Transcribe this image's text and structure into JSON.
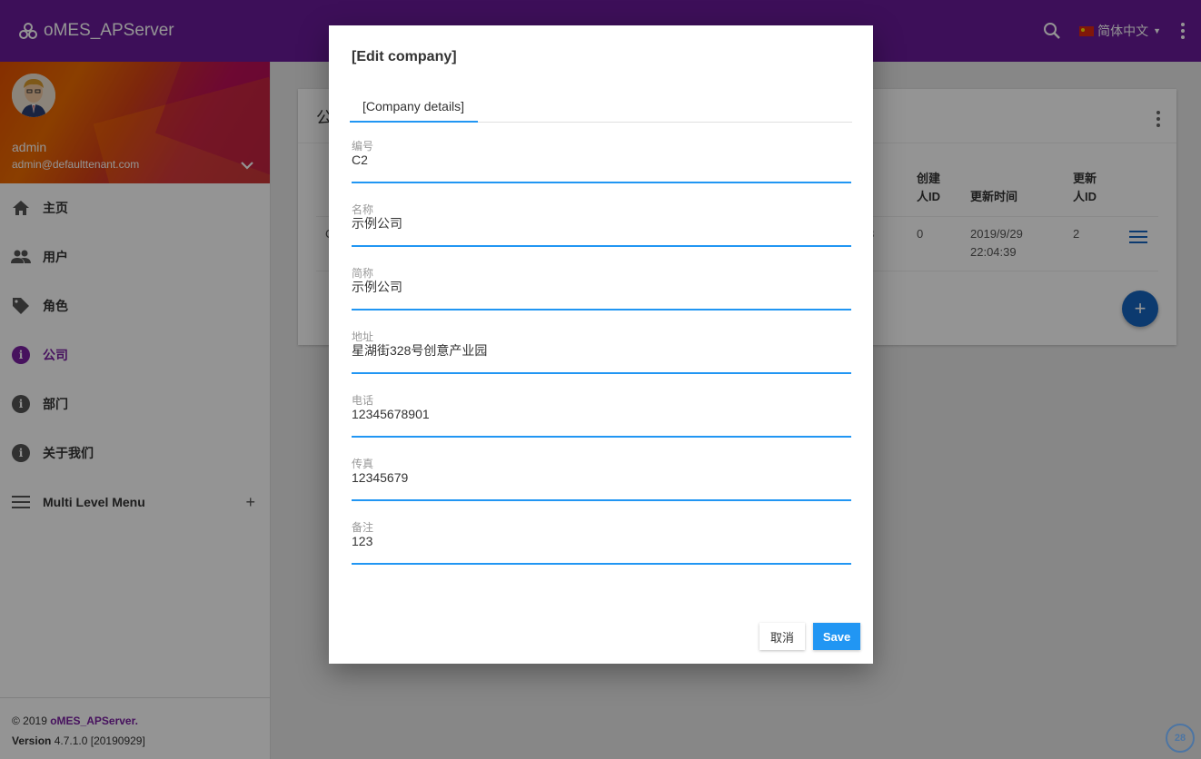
{
  "app": {
    "title": "oMES_APServer"
  },
  "header": {
    "language": "简体中文"
  },
  "user": {
    "name": "admin",
    "email": "admin@defaulttenant.com"
  },
  "sidebar": {
    "items": [
      {
        "label": "主页",
        "icon": "home-icon"
      },
      {
        "label": "用户",
        "icon": "people-icon"
      },
      {
        "label": "角色",
        "icon": "tag-icon"
      },
      {
        "label": "公司",
        "icon": "info-icon",
        "active": true
      },
      {
        "label": "部门",
        "icon": "info-icon"
      },
      {
        "label": "关于我们",
        "icon": "info-icon"
      },
      {
        "label": "Multi Level Menu",
        "icon": "menu-icon"
      }
    ]
  },
  "footer": {
    "copyright": "© 2019",
    "app": "oMES_APServer",
    "dot": ".",
    "version_label": "Version",
    "version": "4.7.1.0 [20190929]"
  },
  "table": {
    "title_partial": "公",
    "headers": {
      "creator": [
        "创建",
        "人ID"
      ],
      "update_time": "更新时间",
      "updater": [
        "更新",
        "人ID"
      ]
    },
    "row": {
      "first_cell": "C",
      "hidden_cell_tail": "3",
      "creator": "0",
      "update_date": "2019/9/29",
      "update_clock": "22:04:39",
      "updater": "2"
    }
  },
  "modal": {
    "title": "[Edit company]",
    "tab": "[Company details]",
    "fields": [
      {
        "label": "编号",
        "value": "C2"
      },
      {
        "label": "名称",
        "value": "示例公司"
      },
      {
        "label": "简称",
        "value": "示例公司"
      },
      {
        "label": "地址",
        "value": "星湖街328号创意产业园"
      },
      {
        "label": "电话",
        "value": "12345678901"
      },
      {
        "label": "传真",
        "value": "12345679"
      },
      {
        "label": "备注",
        "value": "123"
      }
    ],
    "cancel": "取消",
    "save": "Save"
  },
  "corner_badge": "28",
  "colors": {
    "primary": "#6a1b9a",
    "accent": "#2196f3",
    "active_menu": "#7b1fa2"
  }
}
